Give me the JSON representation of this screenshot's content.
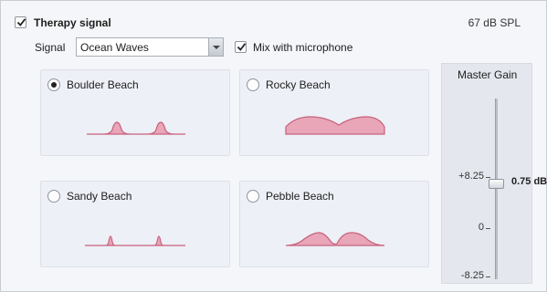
{
  "therapy": {
    "enabled": true,
    "title": "Therapy signal",
    "level": "67 dB SPL"
  },
  "signal": {
    "label": "Signal",
    "selected": "Ocean Waves",
    "mix_checked": true,
    "mix_label": "Mix with microphone"
  },
  "presets": [
    {
      "label": "Boulder Beach",
      "selected": true
    },
    {
      "label": "Rocky Beach",
      "selected": false
    },
    {
      "label": "Sandy Beach",
      "selected": false
    },
    {
      "label": "Pebble Beach",
      "selected": false
    }
  ],
  "gain": {
    "title": "Master Gain",
    "ticks": [
      "+8.25",
      "0",
      "-8.25"
    ],
    "value": 0.75,
    "value_label": "0.75 dB"
  },
  "colors": {
    "wave_fill": "#e8a6b8",
    "wave_stroke": "#c8607c"
  }
}
